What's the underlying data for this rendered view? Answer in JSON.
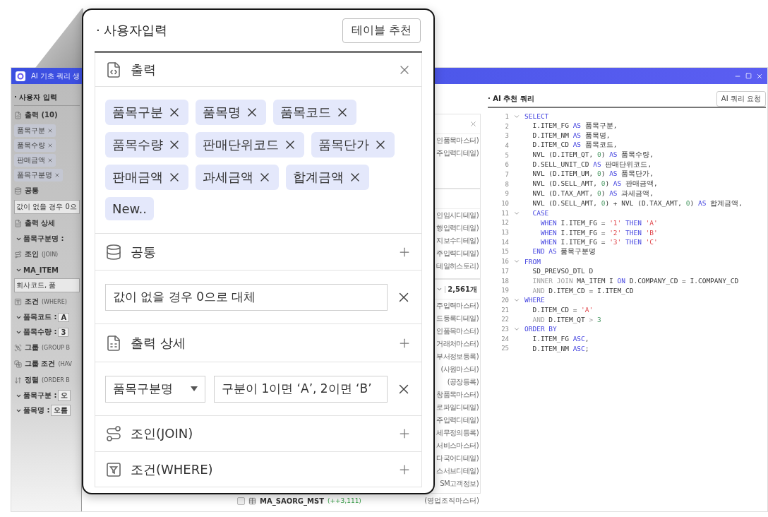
{
  "window": {
    "title": "AI 기초 쿼리 생"
  },
  "left_panel": {
    "title": "· 사용자 입력",
    "sections": [
      {
        "kind": "output",
        "title": "출력 (10)",
        "chips": [
          "품목구분",
          "품목수량",
          "판매금액",
          "품목구분명"
        ]
      },
      {
        "kind": "common",
        "title": "공통",
        "field": "값이 없을 경우 0으"
      },
      {
        "kind": "detail",
        "title": "출력 상세",
        "rows": [
          {
            "label": "품목구분명 :"
          }
        ]
      },
      {
        "kind": "join",
        "title": "조인",
        "hint": "(JOIN)",
        "rows": [
          {
            "label": "MA_ITEM"
          }
        ],
        "field": "회사코드, 품"
      },
      {
        "kind": "where",
        "title": "조건",
        "hint": "(WHERE)",
        "rows": [
          {
            "label": "품목코드 :",
            "value": "A"
          },
          {
            "label": "품목수량 :",
            "value": "3"
          }
        ]
      },
      {
        "kind": "group",
        "title": "그룹",
        "hint": "(GROUP B"
      },
      {
        "kind": "having",
        "title": "그룹 조건",
        "hint": "(HAV"
      },
      {
        "kind": "order",
        "title": "정렬",
        "hint": "(ORDER B",
        "rows": [
          {
            "label": "품목구분 :",
            "value": "오"
          },
          {
            "label": "품목명 :",
            "value": "오름"
          }
        ]
      }
    ]
  },
  "table_list": {
    "groups": [
      {
        "kind": "closable",
        "rows": [
          "인품목마스터)",
          "주입력디테일)"
        ]
      },
      {
        "kind": "plain",
        "rows": [
          "인임시디테일)",
          "행입력디테일)",
          "지보수디테일)",
          "주입력디테일)",
          "테일히스토리)"
        ]
      },
      {
        "kind": "counted",
        "count": "2,561개",
        "rows": [
          "주입력마스터)",
          "드등록디테일)",
          "인품목마스터)",
          "거래처마스터)",
          "부서정보등록)",
          "(사원마스터)",
          "(공장등록)",
          "창품목마스터)",
          "로파일디테일)",
          "주입력디테일)",
          "세무정의등록)",
          "서비스마스터)",
          "다국어디테일)",
          "스서브디테일)",
          "SM고객정보)"
        ]
      }
    ],
    "last_row": {
      "checked": false,
      "name": "MA_SAORG_MST",
      "count": "(++3,111)",
      "description": "(영업조직마스터)"
    }
  },
  "code_panel": {
    "title": "· AI 추천 쿼리",
    "button": "AI 쿼리 요청",
    "lines": [
      {
        "num": "1",
        "fold": true,
        "tokens": [
          {
            "kind": "keyword",
            "text": "SELECT"
          }
        ]
      },
      {
        "num": "2",
        "fold": false,
        "tokens": [
          {
            "kind": "text",
            "text": "  I.ITEM_FG "
          },
          {
            "kind": "keyword",
            "text": "AS"
          },
          {
            "kind": "text",
            "text": " 품목구분,"
          }
        ]
      },
      {
        "num": "3",
        "fold": false,
        "tokens": [
          {
            "kind": "text",
            "text": "  D.ITEM_NM "
          },
          {
            "kind": "keyword",
            "text": "AS"
          },
          {
            "kind": "text",
            "text": " 품목명,"
          }
        ]
      },
      {
        "num": "4",
        "fold": false,
        "tokens": [
          {
            "kind": "text",
            "text": "  D.ITEM_CD "
          },
          {
            "kind": "keyword",
            "text": "AS"
          },
          {
            "kind": "text",
            "text": " 품목코드,"
          }
        ]
      },
      {
        "num": "5",
        "fold": false,
        "tokens": [
          {
            "kind": "text",
            "text": "  NVL (D.ITEM_QT, "
          },
          {
            "kind": "number",
            "text": "0"
          },
          {
            "kind": "text",
            "text": ") "
          },
          {
            "kind": "keyword",
            "text": "AS"
          },
          {
            "kind": "text",
            "text": " 품목수량,"
          }
        ]
      },
      {
        "num": "6",
        "fold": false,
        "tokens": [
          {
            "kind": "text",
            "text": "  D.SELL_UNIT_CD "
          },
          {
            "kind": "keyword",
            "text": "AS"
          },
          {
            "kind": "text",
            "text": " 판매단위코드,"
          }
        ]
      },
      {
        "num": "7",
        "fold": false,
        "tokens": [
          {
            "kind": "text",
            "text": "  NVL (D.ITEM_UM, "
          },
          {
            "kind": "number",
            "text": "0"
          },
          {
            "kind": "text",
            "text": ") "
          },
          {
            "kind": "keyword",
            "text": "AS"
          },
          {
            "kind": "text",
            "text": " 품목단가,"
          }
        ]
      },
      {
        "num": "8",
        "fold": false,
        "tokens": [
          {
            "kind": "text",
            "text": "  NVL (D.SELL_AMT, "
          },
          {
            "kind": "number",
            "text": "0"
          },
          {
            "kind": "text",
            "text": ") "
          },
          {
            "kind": "keyword",
            "text": "AS"
          },
          {
            "kind": "text",
            "text": " 판매금액,"
          }
        ]
      },
      {
        "num": "9",
        "fold": false,
        "tokens": [
          {
            "kind": "text",
            "text": "  NVL (D.TAX_AMT, "
          },
          {
            "kind": "number",
            "text": "0"
          },
          {
            "kind": "text",
            "text": ") "
          },
          {
            "kind": "keyword",
            "text": "AS"
          },
          {
            "kind": "text",
            "text": " 과세금액,"
          }
        ]
      },
      {
        "num": "10",
        "fold": false,
        "tokens": [
          {
            "kind": "text",
            "text": "  NVL (D.SELL_AMT, "
          },
          {
            "kind": "number",
            "text": "0"
          },
          {
            "kind": "text",
            "text": ") + NVL (D.TAX_AMT, "
          },
          {
            "kind": "number",
            "text": "0"
          },
          {
            "kind": "text",
            "text": ") "
          },
          {
            "kind": "keyword",
            "text": "AS"
          },
          {
            "kind": "text",
            "text": " 합계금액,"
          }
        ]
      },
      {
        "num": "11",
        "fold": true,
        "tokens": [
          {
            "kind": "keyword",
            "text": "  CASE"
          }
        ]
      },
      {
        "num": "12",
        "fold": false,
        "tokens": [
          {
            "kind": "keyword",
            "text": "    WHEN"
          },
          {
            "kind": "text",
            "text": " I.ITEM_FG = "
          },
          {
            "kind": "string",
            "text": "'1'"
          },
          {
            "kind": "keyword",
            "text": " THEN "
          },
          {
            "kind": "string",
            "text": "'A'"
          }
        ]
      },
      {
        "num": "13",
        "fold": false,
        "tokens": [
          {
            "kind": "keyword",
            "text": "    WHEN"
          },
          {
            "kind": "text",
            "text": " I.ITEM_FG = "
          },
          {
            "kind": "string",
            "text": "'2'"
          },
          {
            "kind": "keyword",
            "text": " THEN "
          },
          {
            "kind": "string",
            "text": "'B'"
          }
        ]
      },
      {
        "num": "14",
        "fold": false,
        "tokens": [
          {
            "kind": "keyword",
            "text": "    WHEN"
          },
          {
            "kind": "text",
            "text": " I.ITEM_FG = "
          },
          {
            "kind": "string",
            "text": "'3'"
          },
          {
            "kind": "keyword",
            "text": " THEN "
          },
          {
            "kind": "string",
            "text": "'C'"
          }
        ]
      },
      {
        "num": "15",
        "fold": false,
        "tokens": [
          {
            "kind": "keyword",
            "text": "  END AS"
          },
          {
            "kind": "text",
            "text": " 품목구분명"
          }
        ]
      },
      {
        "num": "16",
        "fold": true,
        "tokens": [
          {
            "kind": "keyword",
            "text": "FROM"
          }
        ]
      },
      {
        "num": "17",
        "fold": false,
        "tokens": [
          {
            "kind": "text",
            "text": "  SD_PREVSO_DTL D"
          }
        ]
      },
      {
        "num": "18",
        "fold": false,
        "tokens": [
          {
            "kind": "muted",
            "text": "  INNER JOIN"
          },
          {
            "kind": "text",
            "text": " MA_ITEM I "
          },
          {
            "kind": "keyword",
            "text": "ON"
          },
          {
            "kind": "text",
            "text": " D.COMPANY_CD = I.COMPANY_CD"
          }
        ]
      },
      {
        "num": "19",
        "fold": false,
        "tokens": [
          {
            "kind": "muted",
            "text": "  AND"
          },
          {
            "kind": "text",
            "text": " D.ITEM_CD = I.ITEM_CD"
          }
        ]
      },
      {
        "num": "20",
        "fold": true,
        "tokens": [
          {
            "kind": "keyword",
            "text": "WHERE"
          }
        ]
      },
      {
        "num": "21",
        "fold": false,
        "tokens": [
          {
            "kind": "text",
            "text": "  D.ITEM_CD = "
          },
          {
            "kind": "string",
            "text": "'A'"
          }
        ]
      },
      {
        "num": "22",
        "fold": false,
        "tokens": [
          {
            "kind": "muted",
            "text": "  AND"
          },
          {
            "kind": "text",
            "text": " D.ITEM_QT "
          },
          {
            "kind": "muted",
            "text": "> "
          },
          {
            "kind": "number",
            "text": "3"
          }
        ]
      },
      {
        "num": "23",
        "fold": true,
        "tokens": [
          {
            "kind": "keyword",
            "text": "ORDER BY"
          }
        ]
      },
      {
        "num": "24",
        "fold": false,
        "tokens": [
          {
            "kind": "text",
            "text": "  I.ITEM_FG "
          },
          {
            "kind": "keyword",
            "text": "ASC"
          },
          {
            "kind": "text",
            "text": ","
          }
        ]
      },
      {
        "num": "25",
        "fold": false,
        "tokens": [
          {
            "kind": "text",
            "text": "  D.ITEM_NM "
          },
          {
            "kind": "keyword",
            "text": "ASC"
          },
          {
            "kind": "text",
            "text": ";"
          }
        ]
      }
    ]
  },
  "callout": {
    "title": "· 사용자입력",
    "button": "테이블 추천",
    "sections": [
      {
        "kind": "output",
        "title": "출력",
        "chips": [
          {
            "kind": "tag",
            "label": "품목구분"
          },
          {
            "kind": "tag",
            "label": "품목명"
          },
          {
            "kind": "tag",
            "label": "품목코드"
          },
          {
            "kind": "tag",
            "label": "품목수량"
          },
          {
            "kind": "tag",
            "label": "판매단위코드"
          },
          {
            "kind": "tag",
            "label": "품목단가"
          },
          {
            "kind": "tag",
            "label": "판매금액"
          },
          {
            "kind": "tag",
            "label": "과세금액"
          },
          {
            "kind": "tag",
            "label": "합계금액"
          },
          {
            "kind": "new",
            "label": "New.."
          }
        ]
      },
      {
        "kind": "common",
        "title": "공통",
        "field": "값이 없을 경우 0으로 대체"
      },
      {
        "kind": "detail",
        "title": "출력 상세",
        "mapping": {
          "column": "품목구분명",
          "value": "구분이 1이면 ‘A’, 2이면 ‘B’"
        }
      },
      {
        "kind": "join",
        "title": "조인(JOIN)"
      },
      {
        "kind": "where",
        "title": "조건(WHERE)"
      }
    ]
  }
}
